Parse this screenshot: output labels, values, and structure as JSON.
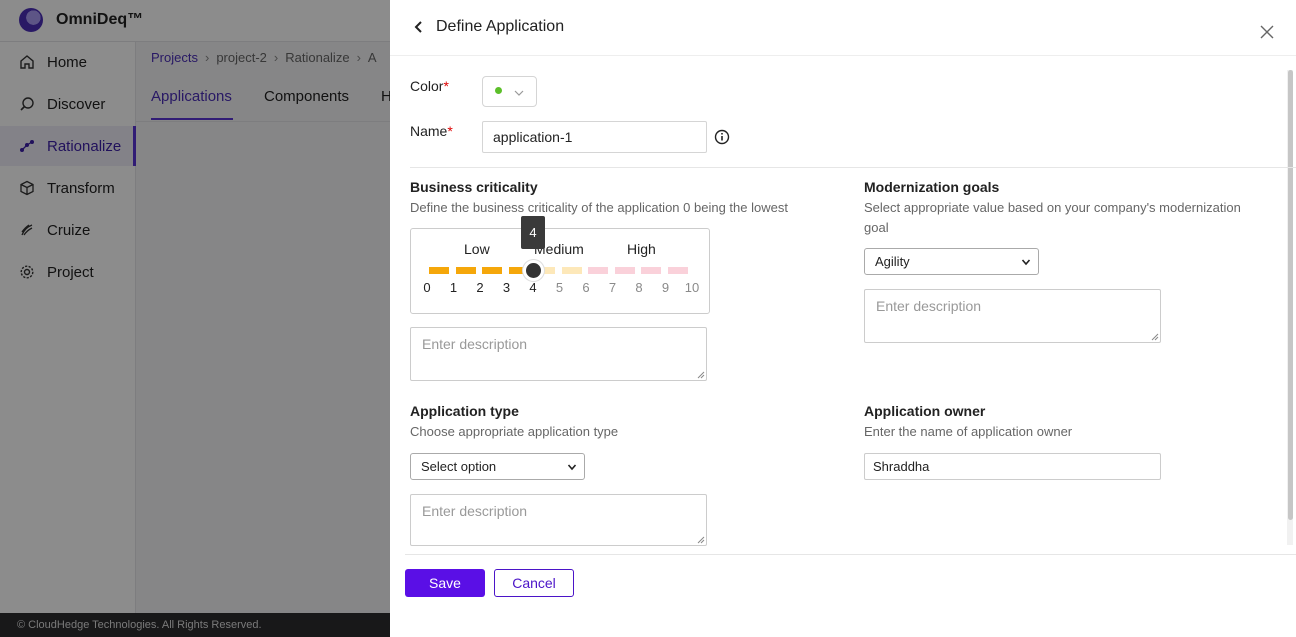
{
  "app": {
    "name": "OmniDeq™",
    "nav": [
      {
        "label": "Home",
        "icon": "home-icon"
      },
      {
        "label": "Discover",
        "icon": "discover-icon"
      },
      {
        "label": "Rationalize",
        "icon": "rationalize-icon",
        "active": true
      },
      {
        "label": "Transform",
        "icon": "transform-icon"
      },
      {
        "label": "Cruize",
        "icon": "cruize-icon"
      },
      {
        "label": "Project",
        "icon": "gear-icon"
      }
    ],
    "breadcrumb": [
      "Projects",
      "project-2",
      "Rationalize",
      "A"
    ],
    "tabs": [
      "Applications",
      "Components",
      "H"
    ],
    "footer": "© CloudHedge Technologies. All Rights Reserved."
  },
  "drawer": {
    "title": "Define Application",
    "color_label": "Color",
    "color_value": "#5cbf2a",
    "name_label": "Name",
    "name_value": "application-1",
    "business_criticality": {
      "title": "Business criticality",
      "description": "Define the business criticality of the application 0 being the lowest",
      "levels": [
        "Low",
        "Medium",
        "High"
      ],
      "ticks": [
        "0",
        "1",
        "2",
        "3",
        "4",
        "5",
        "6",
        "7",
        "8",
        "9",
        "10"
      ],
      "value": 4,
      "tooltip": "4",
      "colors": {
        "low": "#f5a70a",
        "low_light": "#fde8b9",
        "high_light": "#fad1da"
      },
      "description_placeholder": "Enter description"
    },
    "modernization_goals": {
      "title": "Modernization goals",
      "description": "Select appropriate value based on your company's modernization goal",
      "selected": "Agility",
      "description_placeholder": "Enter description"
    },
    "application_type": {
      "title": "Application type",
      "description": "Choose appropriate application type",
      "selected": "Select option",
      "description_placeholder": "Enter description"
    },
    "application_owner": {
      "title": "Application owner",
      "description": "Enter the name of application owner",
      "value": "Shraddha"
    },
    "save_label": "Save",
    "cancel_label": "Cancel"
  }
}
